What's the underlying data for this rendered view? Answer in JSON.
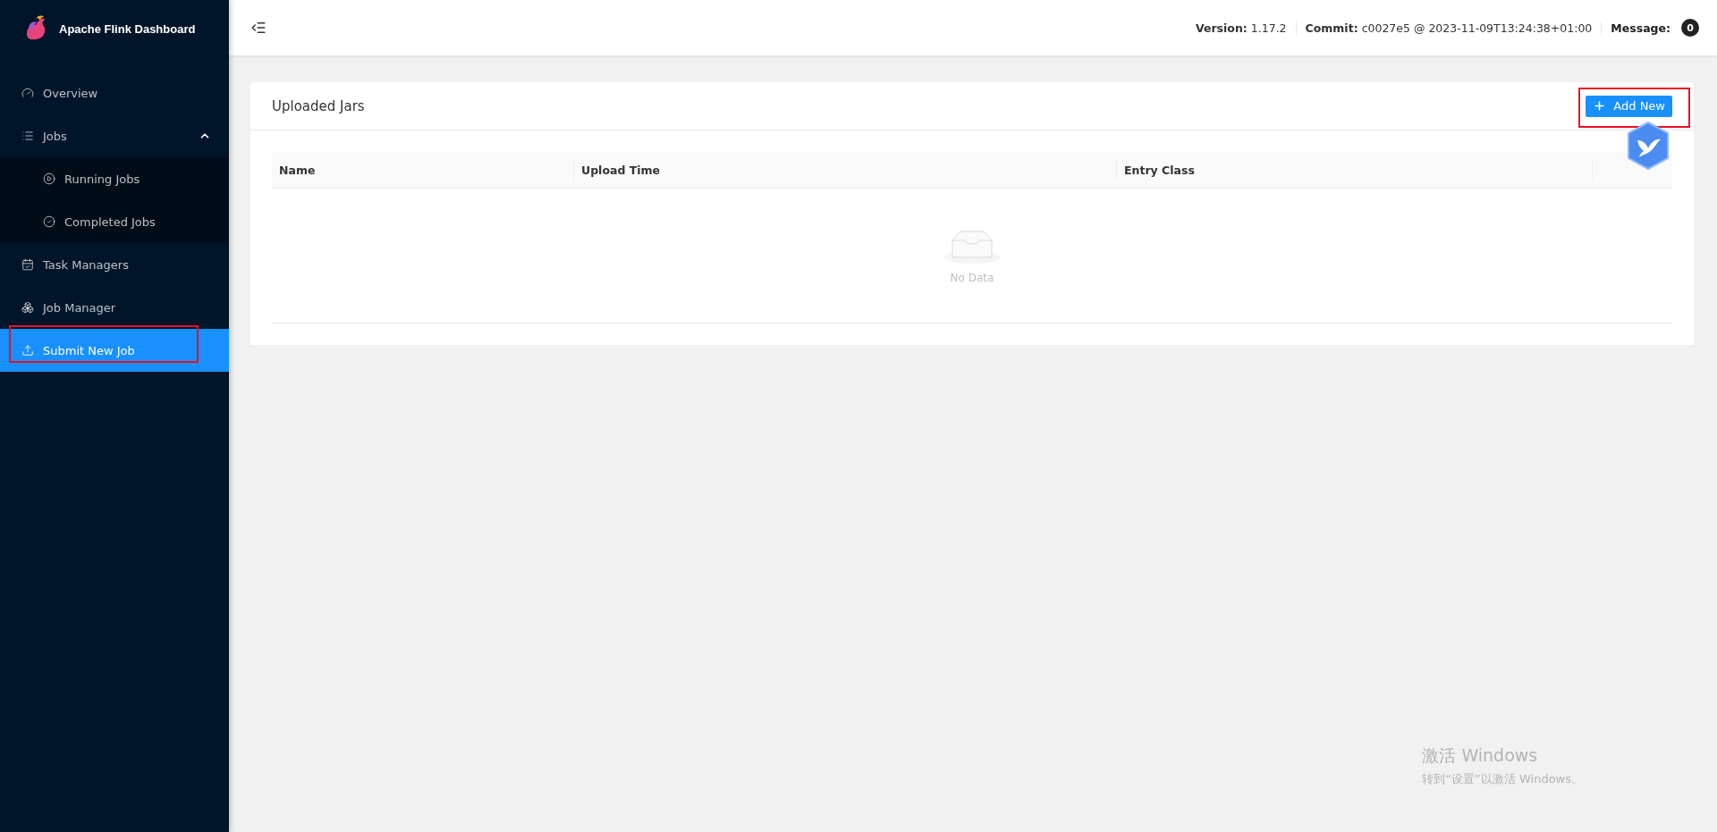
{
  "sidebar": {
    "title": "Apache Flink Dashboard",
    "items": [
      {
        "label": "Overview",
        "selected": false,
        "annotated": false
      },
      {
        "label": "Jobs",
        "selected": false,
        "annotated": false,
        "expanded": true,
        "children": [
          {
            "label": "Running Jobs",
            "selected": false,
            "annotated": false
          },
          {
            "label": "Completed Jobs",
            "selected": false,
            "annotated": false
          }
        ]
      },
      {
        "label": "Task Managers",
        "selected": false,
        "annotated": false
      },
      {
        "label": "Job Manager",
        "selected": false,
        "annotated": false
      },
      {
        "label": "Submit New Job",
        "selected": true,
        "annotated": true
      }
    ]
  },
  "header": {
    "info": [
      {
        "label": "Version:",
        "value": "1.17.2"
      },
      {
        "label": "Commit:",
        "value": "c0027e5 @ 2023-11-09T13:24:38+01:00"
      },
      {
        "label": "Message:",
        "badge": "0"
      }
    ]
  },
  "card": {
    "title": "Uploaded Jars",
    "add_button": {
      "label": "Add New",
      "annotated": true
    },
    "table": {
      "columns": [
        "Name",
        "Upload Time",
        "Entry Class"
      ],
      "empty_text": "No Data"
    }
  },
  "os_notice": {
    "title": "激活 Windows",
    "text": "转到“设置”以激活 Windows。"
  }
}
